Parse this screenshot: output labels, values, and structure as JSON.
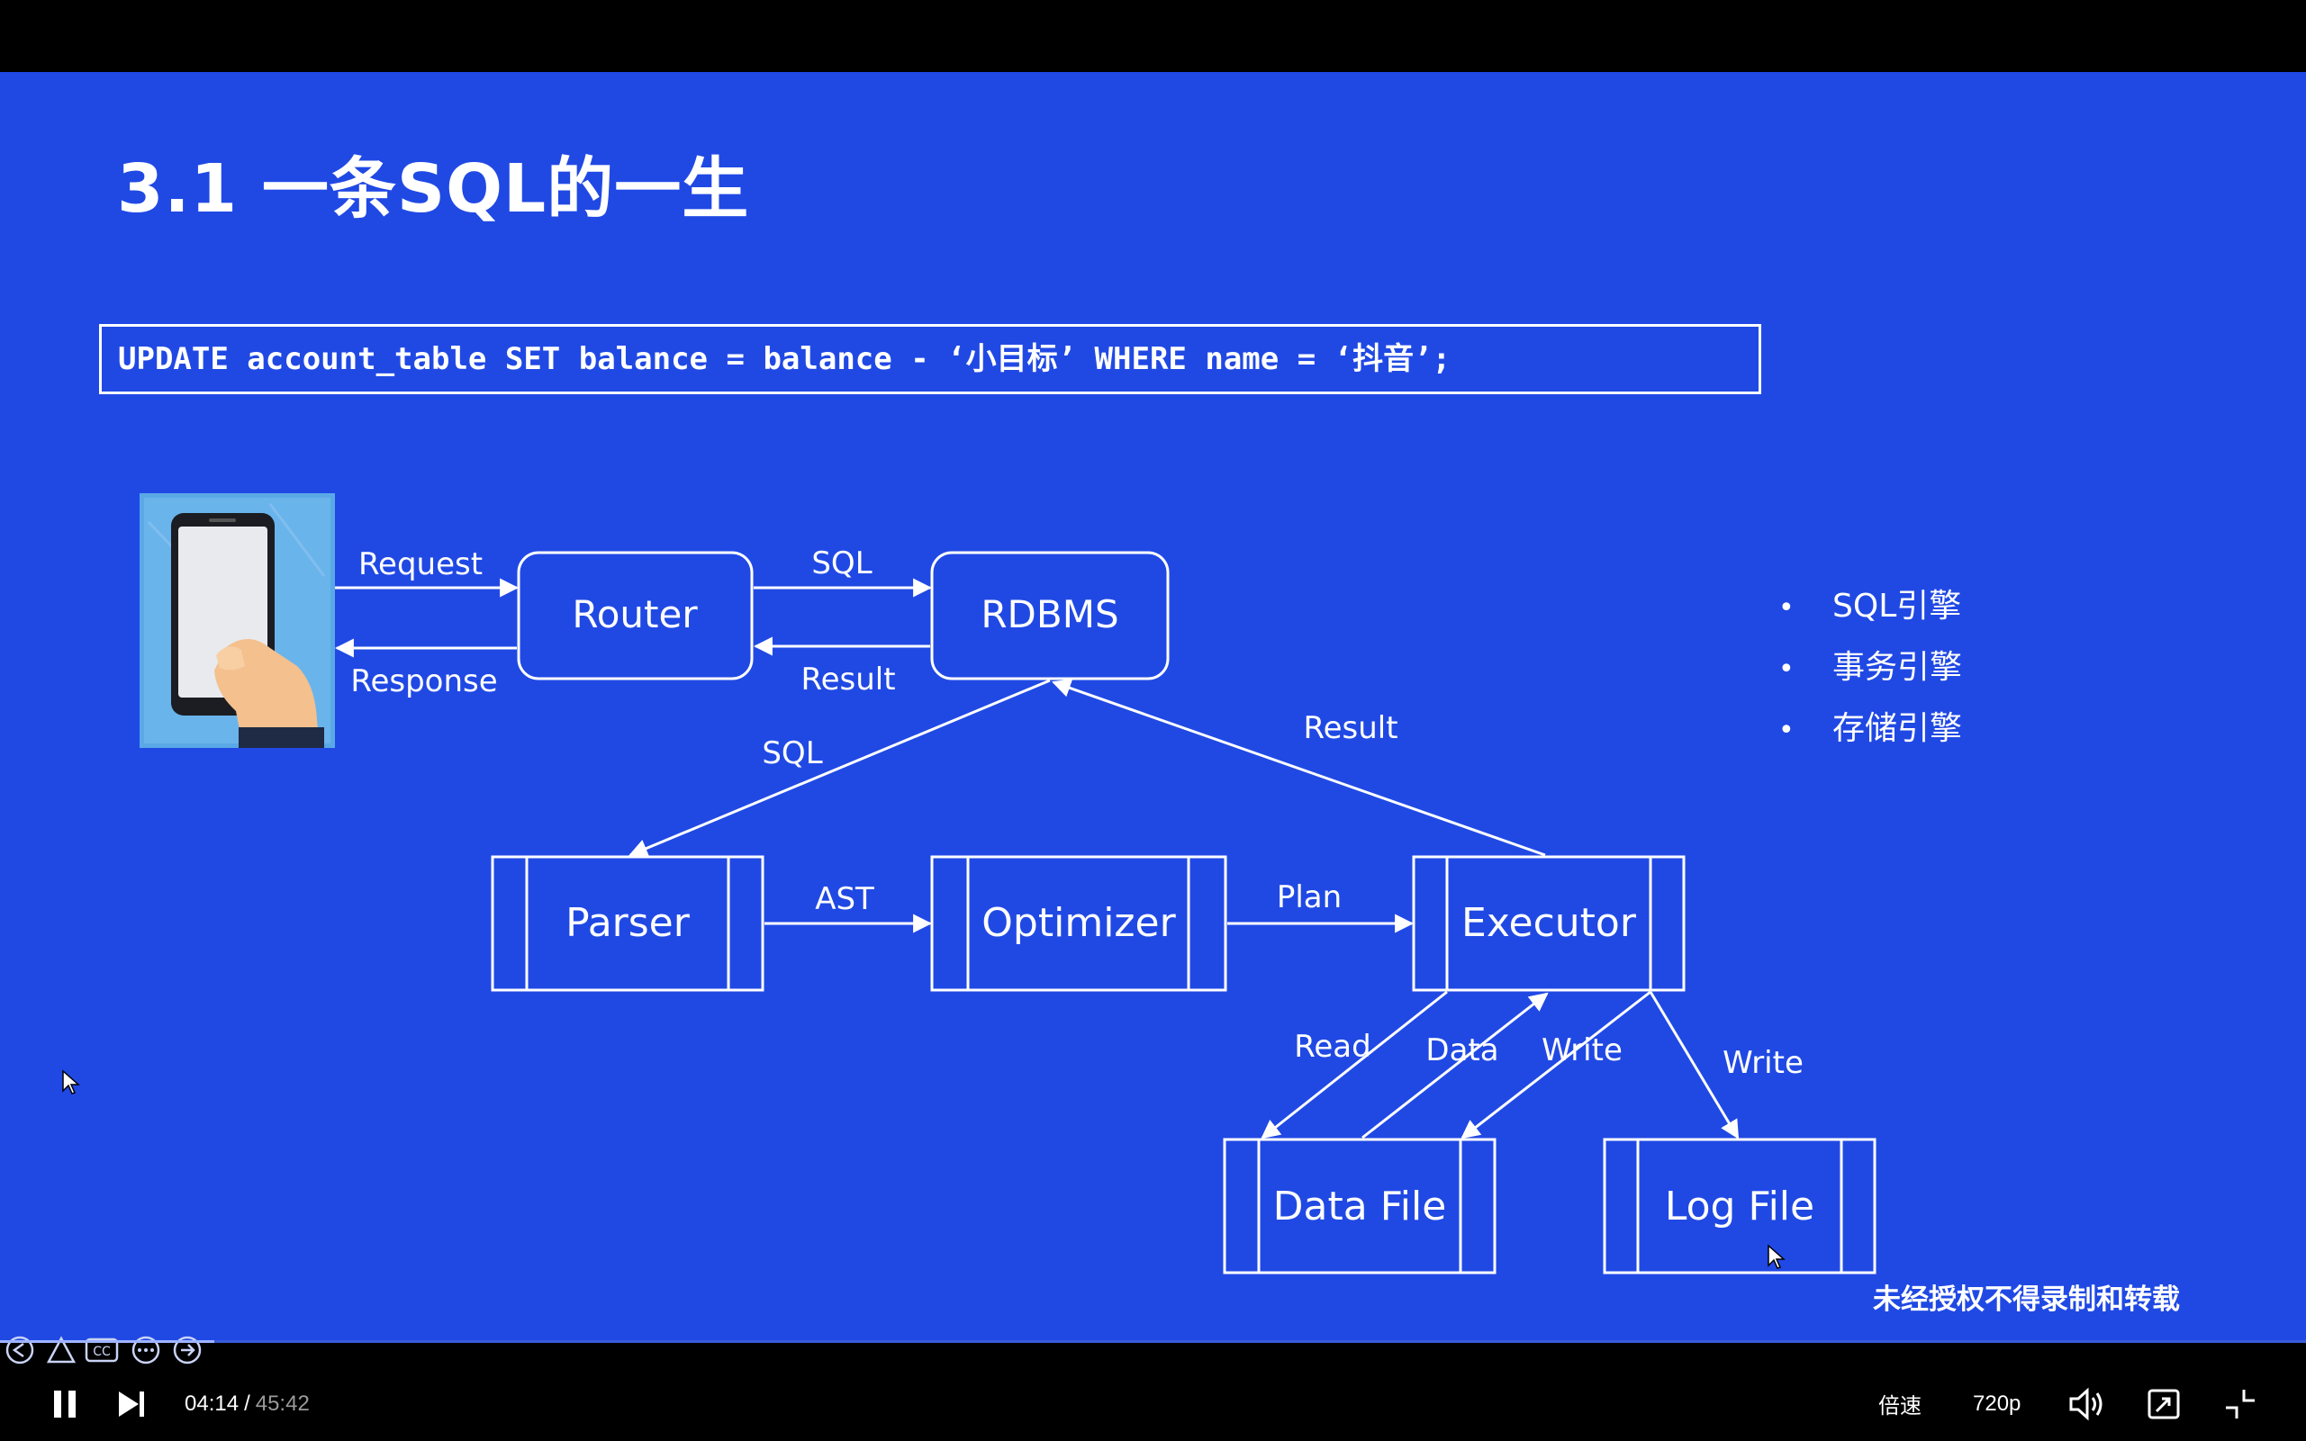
{
  "slide": {
    "title": "3.1 一条SQL的一生",
    "sql_statement": "UPDATE account_table SET balance = balance - ‘小目标’ WHERE name = ‘抖音’;",
    "diagram": {
      "nodes": {
        "router": "Router",
        "rdbms": "RDBMS",
        "parser": "Parser",
        "optimizer": "Optimizer",
        "executor": "Executor",
        "data_file": "Data File",
        "log_file": "Log File"
      },
      "edges": {
        "request": "Request",
        "response": "Response",
        "sql_top": "SQL",
        "result_top": "Result",
        "sql_down": "SQL",
        "result_up": "Result",
        "ast": "AST",
        "plan": "Plan",
        "read": "Read",
        "data": "Data",
        "write_data": "Write",
        "write_log": "Write"
      }
    },
    "bullets": [
      "SQL引擎",
      "事务引擎",
      "存储引擎"
    ],
    "watermark": "未经授权不得录制和转载"
  },
  "player": {
    "current_time": "04:14",
    "separator": "/",
    "total_time": "45:42",
    "speed_label": "倍速",
    "quality_label": "720p",
    "progress_fraction": 0.093,
    "icons": [
      "pause-icon",
      "next-icon",
      "volume-icon",
      "pip-icon",
      "exit-fullscreen-icon"
    ]
  },
  "colors": {
    "slide_background": "#2049e4",
    "foreground": "#ffffff"
  }
}
